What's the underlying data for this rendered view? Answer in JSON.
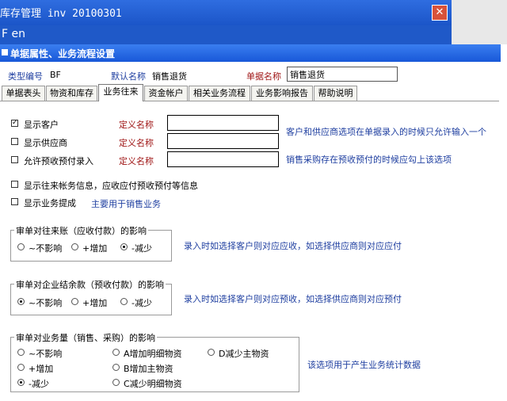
{
  "outer_window": {
    "title": "库存管理 inv 20100301",
    "strip_text": "F en",
    "close_symbol": "✕"
  },
  "dialog": {
    "title": "单据属性、业务流程设置"
  },
  "header": {
    "type_code_label": "类型编号",
    "type_code_value": "BF",
    "default_name_label": "默认名称",
    "default_name_value": "销售退货",
    "doc_name_label": "单据名称",
    "doc_name_value": "销售退货"
  },
  "tabs": [
    {
      "label": "单据表头"
    },
    {
      "label": "物资和库存"
    },
    {
      "label": "业务往来"
    },
    {
      "label": "资金帐户"
    },
    {
      "label": "相关业务流程"
    },
    {
      "label": "业务影响报告"
    },
    {
      "label": "帮助说明"
    }
  ],
  "active_tab": "业务往来",
  "options": {
    "show_customer": {
      "label": "显示客户",
      "checked": true,
      "define_label": "定义名称",
      "value": ""
    },
    "show_supplier": {
      "label": "显示供应商",
      "checked": false,
      "define_label": "定义名称",
      "value": ""
    },
    "allow_prepay": {
      "label": "允许预收预付录入",
      "checked": false,
      "define_label": "定义名称",
      "value": ""
    },
    "customer_note": "客户和供应商选项在单据录入的时候只允许输入一个",
    "prepay_note": "销售采购存在预收预付的时候应勾上该选项",
    "show_account_info": {
      "label": "显示往来帐务信息，应收应付预收预付等信息",
      "checked": false
    },
    "show_commission": {
      "label": "显示业务提成",
      "checked": false
    },
    "commission_note": "主要用于销售业务"
  },
  "group_receivable": {
    "title": "审单对往来账（应收付款）的影响",
    "options": [
      "~不影响",
      "+增加",
      "-减少"
    ],
    "selected": 2,
    "note": "录入时如选择客户则对应应收，如选择供应商则对应应付"
  },
  "group_balance": {
    "title": "审单对企业结余款（预收付款）的影响",
    "options": [
      "~不影响",
      "+增加",
      "-减少"
    ],
    "selected": 0,
    "note": "录入时如选择客户则对应预收，如选择供应商则对应预付"
  },
  "group_volume": {
    "title": "审单对业务量（销售、采购）的影响",
    "options": [
      "~不影响",
      "+增加",
      "-减少",
      "A增加明细物资",
      "B增加主物资",
      "C减少明细物资",
      "D减少主物资"
    ],
    "selected": 2,
    "note": "该选项用于产生业务统计数据"
  }
}
